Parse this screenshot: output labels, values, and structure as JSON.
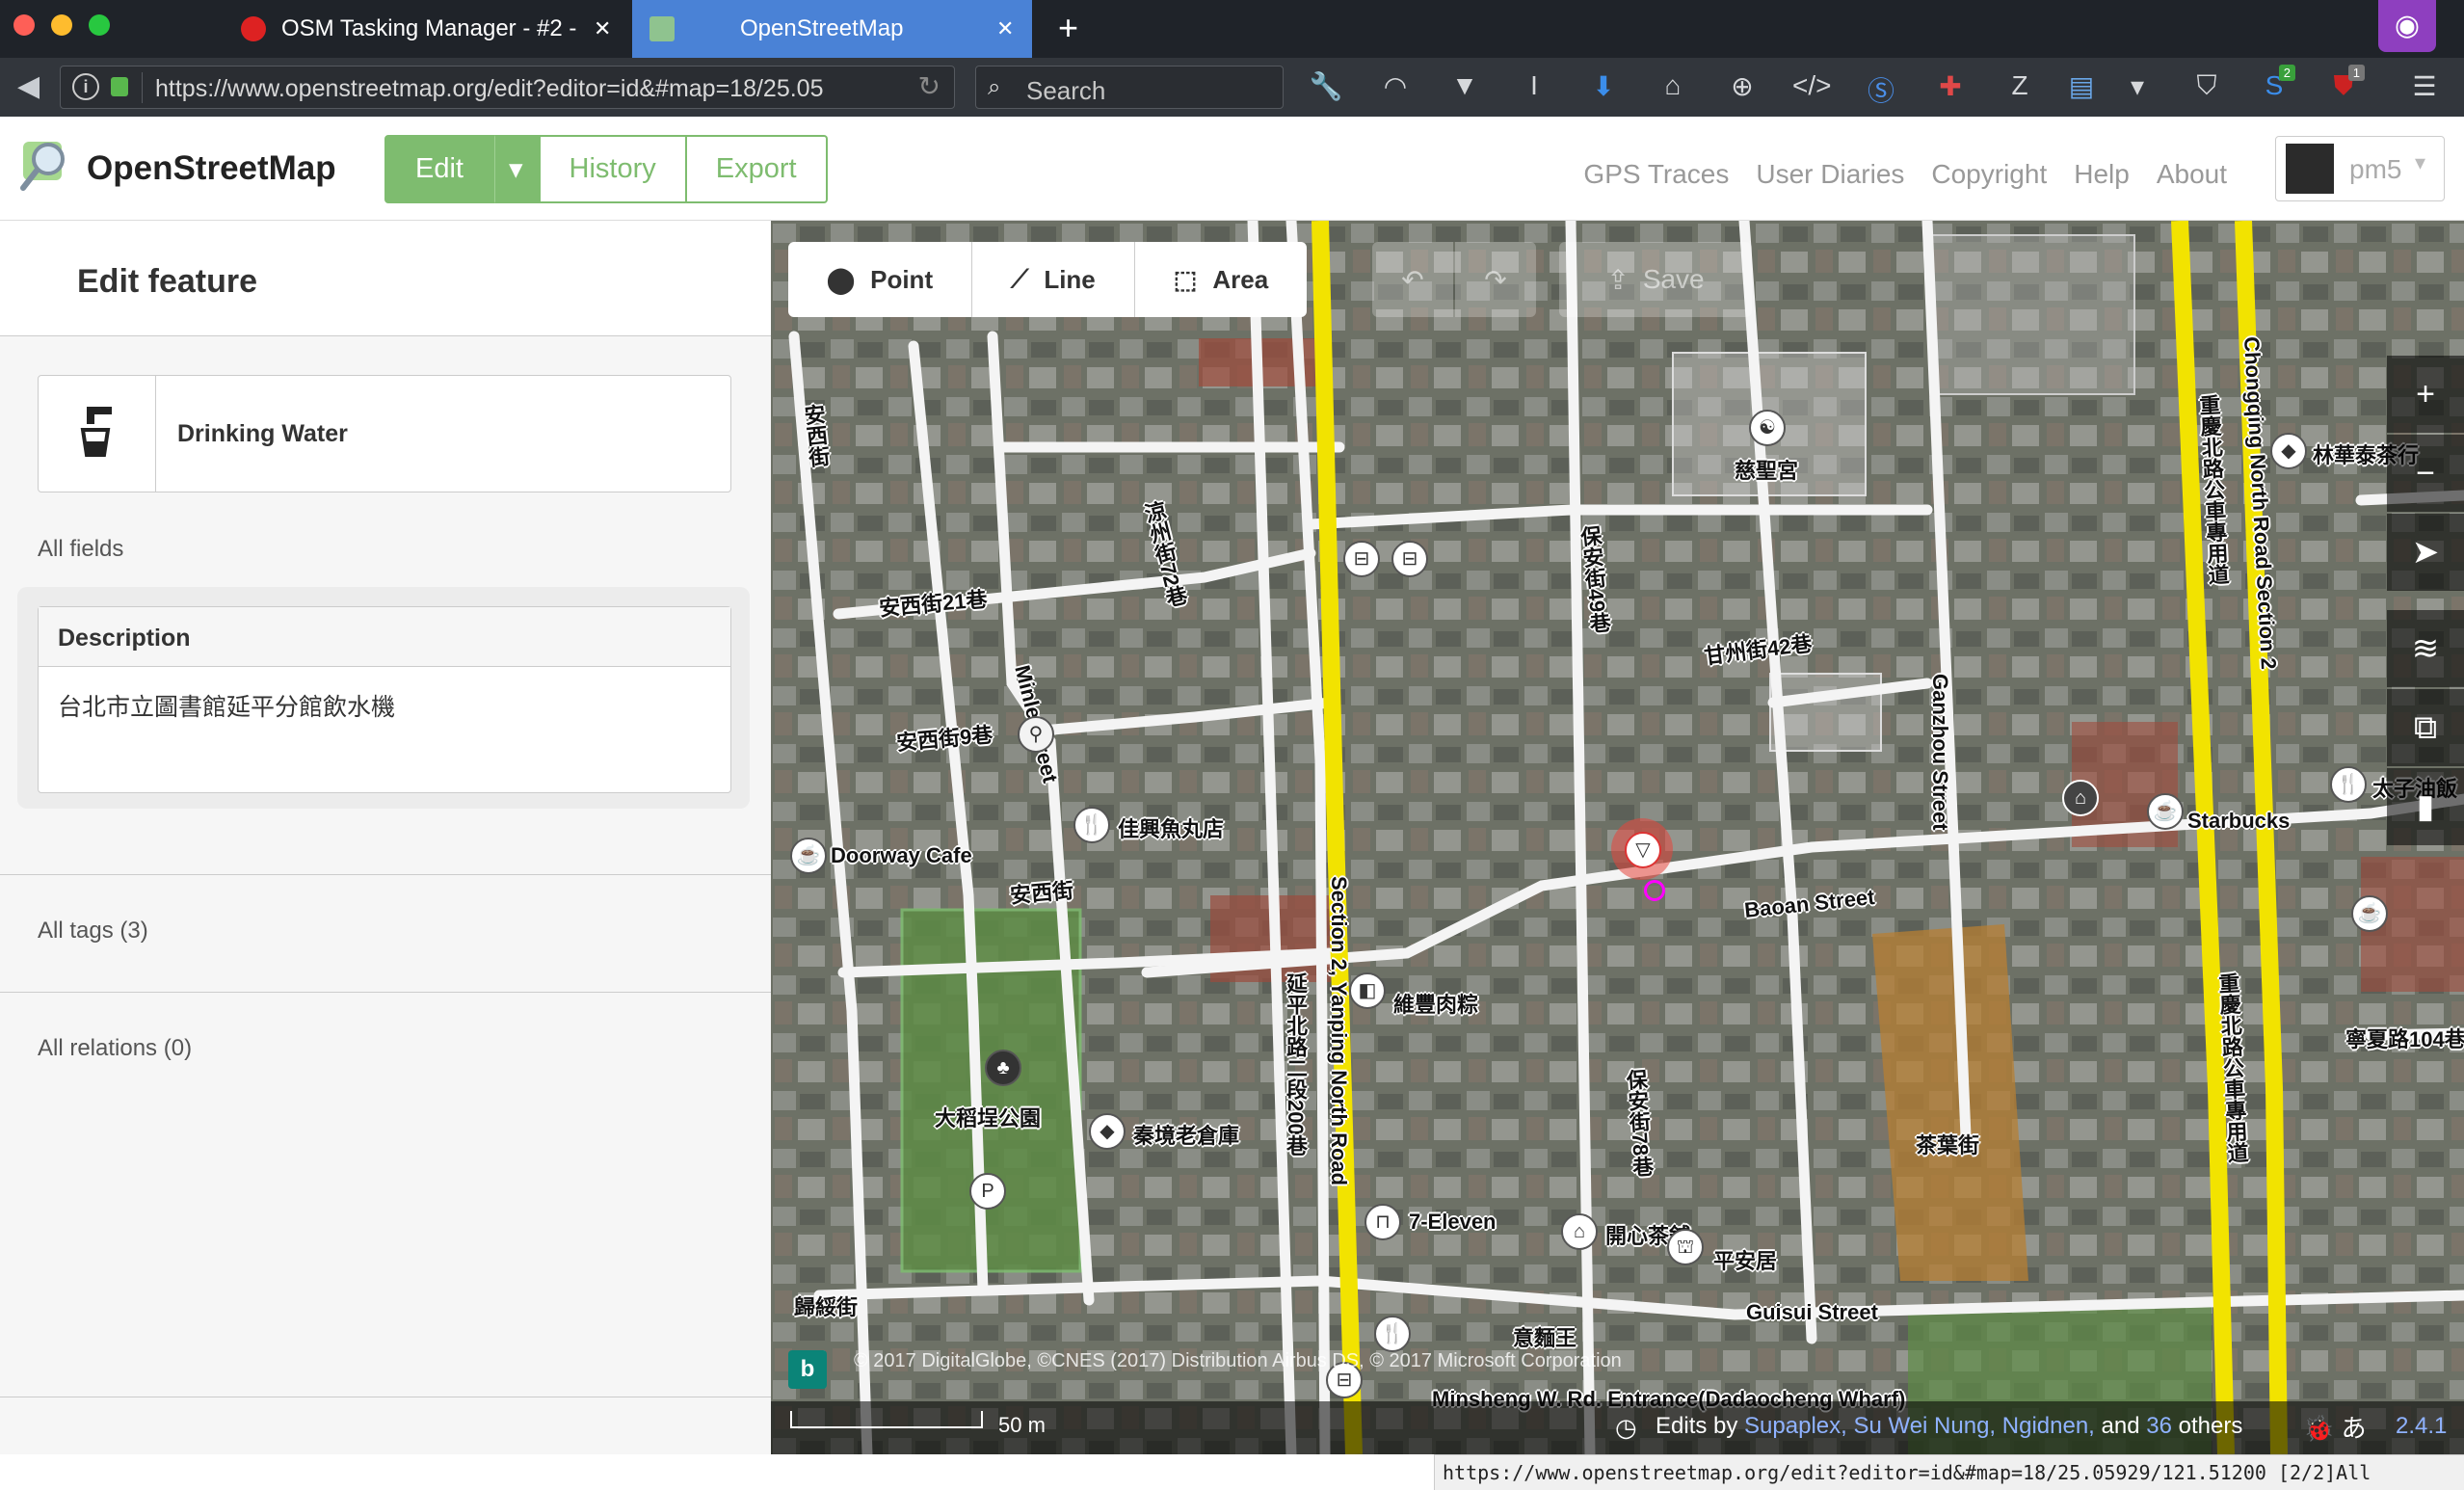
{
  "browser": {
    "tabs": [
      {
        "title": "OSM Tasking Manager - #2 -",
        "active": false
      },
      {
        "title": "OpenStreetMap",
        "active": true
      }
    ],
    "new_tab_icon": "plus-icon",
    "address": "https://www.openstreetmap.org/edit?editor=id&#map=18/25.05",
    "search_placeholder": "Search",
    "status_url": "https://www.openstreetmap.org/edit?editor=id&#map=18/25.05929/121.51200 [2/2]All",
    "badges": {
      "shield_count": "2",
      "ublock_count": "1"
    }
  },
  "header": {
    "brand": "OpenStreetMap",
    "edit_label": "Edit",
    "history_label": "History",
    "export_label": "Export",
    "nav": [
      "GPS Traces",
      "User Diaries",
      "Copyright",
      "Help",
      "About"
    ],
    "username": "pm5"
  },
  "sidebar": {
    "title": "Edit feature",
    "preset_name": "Drinking Water",
    "all_fields": "All fields",
    "description_label": "Description",
    "description_value": "台北市立圖書館延平分館飲水機",
    "all_tags": "All tags (3)",
    "all_relations": "All relations (0)"
  },
  "map": {
    "tools": [
      {
        "label": "Point",
        "icon": "point-icon"
      },
      {
        "label": "Line",
        "icon": "line-icon"
      },
      {
        "label": "Area",
        "icon": "area-icon"
      }
    ],
    "save_label": "Save",
    "street_labels": {
      "anxi": "安西街",
      "minle": "Minle Street",
      "yanping": "Section 2, Yanping North Road",
      "ganzhou": "Ganzhou Street",
      "baoan": "Baoan Street",
      "guisui": "Guisui Street",
      "chongqing": "Chongqing North Road Section 2",
      "anxi21": "安西街21巷",
      "anxi9": "安西街9巷",
      "liangzhou72": "涼州街72巷",
      "baoan49": "保安街49巷",
      "ganzhou42": "甘州街42巷",
      "baoan78": "保安街78巷",
      "yanping200": "延平北路二段200巷",
      "guisui_zh": "歸綏街",
      "chayejie": "茶葉街",
      "ningxia": "寧夏路104巷",
      "chongqing_bus1": "重慶北路公車專用道",
      "chongqing_bus2": "重慶北路公車專用道"
    },
    "poi_labels": {
      "cisheng": "慈聖宮",
      "doorway": "Doorway Cafe",
      "jiaxing": "佳興魚丸店",
      "park": "大稻埕公園",
      "qinjing": "秦境老倉庫",
      "weifeng": "維豐肉粽",
      "seven": "7-Eleven",
      "happy": "開心茶舖",
      "pinganju": "平安居",
      "yimian": "意麵王",
      "wharf": "Minsheng W. Rd. Entrance(Dadaocheng Wharf)",
      "linhuatai": "林華泰茶行",
      "starbucks": "Starbucks",
      "taizi": "太子油飯"
    },
    "attribution": "© 2017 DigitalGlobe, ©CNES (2017) Distribution Airbus DS, © 2017 Microsoft Corporation",
    "scale_label": "50 m",
    "contrib_prefix": "Edits by",
    "contributors": "Supaplex, Su Wei Nung, Ngidnen,",
    "contrib_and": "and",
    "contrib_count": "36",
    "contrib_suffix": "others",
    "version": "2.4.1"
  },
  "colors": {
    "osm_green": "#7ebc6f",
    "link_blue": "#8fb2ff",
    "major_road": "#f2e300"
  }
}
